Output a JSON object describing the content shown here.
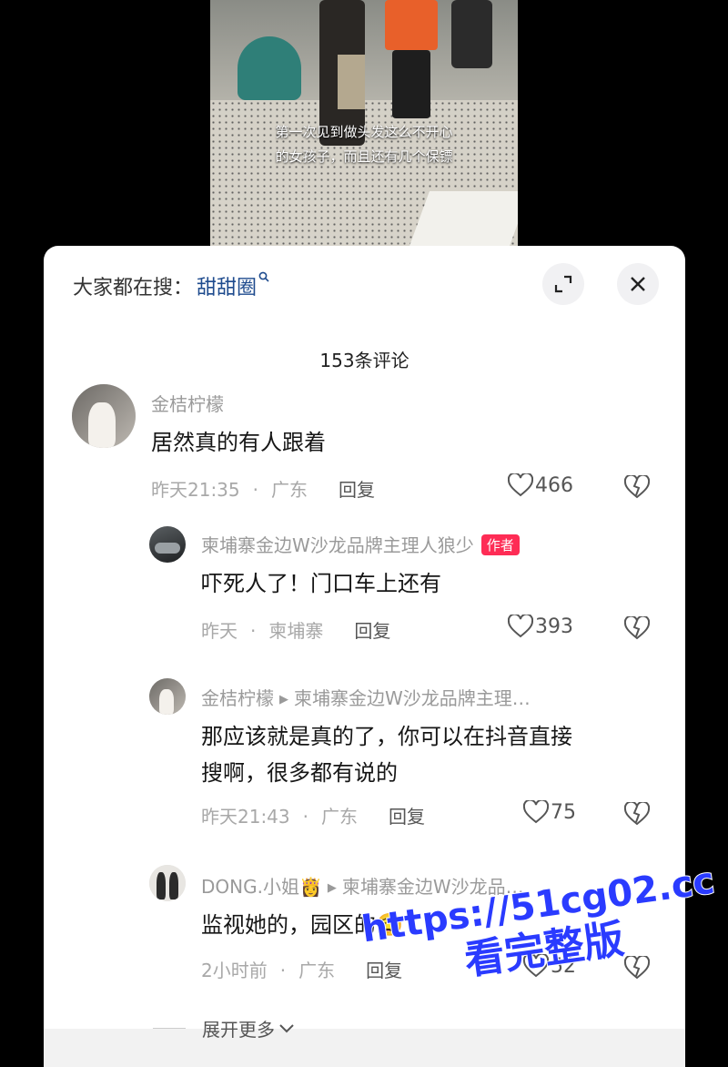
{
  "video": {
    "caption_line1": "第一次见到做头发这么不开心",
    "caption_line2": "的女孩子，而且还有几个保镖"
  },
  "header": {
    "search_prefix": "大家都在搜：",
    "search_term": "甜甜圈",
    "comments_count": "153条评论"
  },
  "comments": [
    {
      "name": "金桔柠檬",
      "text": "居然真的有人跟着",
      "time": "昨天21:35",
      "location": "广东",
      "reply": "回复",
      "likes": "466"
    },
    {
      "name": "柬埔寨金边W沙龙品牌主理人狼少",
      "badge": "作者",
      "text": "吓死人了！门口车上还有",
      "time": "昨天",
      "location": "柬埔寨",
      "reply": "回复",
      "likes": "393"
    },
    {
      "name": "金桔柠檬",
      "reply_to": "柬埔寨金边W沙龙品牌主理…",
      "text_line1": "那应该就是真的了，你可以在抖音直接",
      "text_line2": "搜啊，很多都有说的",
      "time": "昨天21:43",
      "location": "广东",
      "reply": "回复",
      "likes": "75"
    },
    {
      "name": "DONG.小姐👸",
      "reply_to": "柬埔寨金边W沙龙品…",
      "text": "监视她的，园区的😮‍💨",
      "time": "2小时前",
      "location": "广东",
      "reply": "回复",
      "likes": "52"
    }
  ],
  "more": {
    "label": "展开更多"
  },
  "watermark": {
    "url": "https://51cg02.cc",
    "text": "看完整版"
  },
  "colors": {
    "accent": "#fe2c55",
    "search_term": "#1e4b8e",
    "watermark": "#2a3bff"
  },
  "icons": [
    "search-icon",
    "expand-icon",
    "close-icon",
    "heart-icon",
    "broken-heart-icon",
    "chevron-down-icon",
    "play-arrow-icon"
  ]
}
